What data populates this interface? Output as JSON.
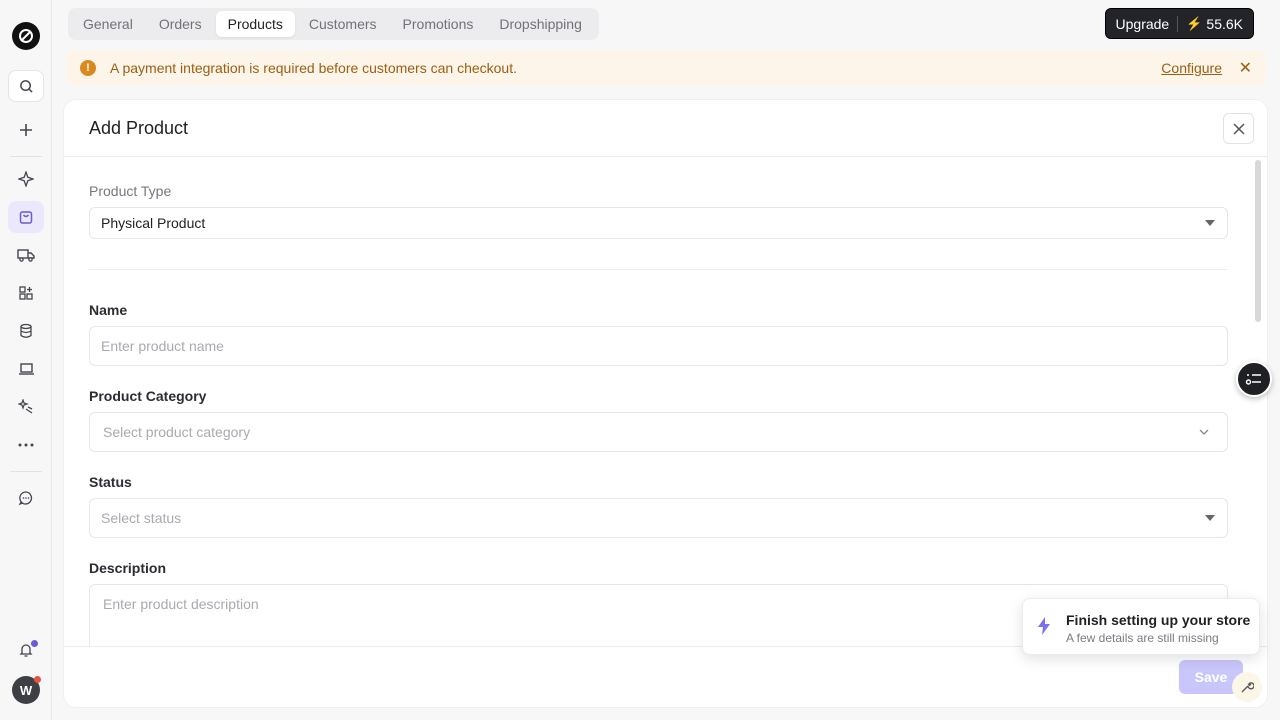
{
  "tabs": [
    {
      "label": "General"
    },
    {
      "label": "Orders"
    },
    {
      "label": "Products"
    },
    {
      "label": "Customers"
    },
    {
      "label": "Promotions"
    },
    {
      "label": "Dropshipping"
    }
  ],
  "active_tab": "Products",
  "upgrade": {
    "label": "Upgrade",
    "credits": "55.6K"
  },
  "banner": {
    "message": "A payment integration is required before customers can checkout.",
    "action": "Configure"
  },
  "panel": {
    "title": "Add Product",
    "product_type": {
      "label": "Product Type",
      "value": "Physical Product"
    },
    "name": {
      "label": "Name",
      "placeholder": "Enter product name"
    },
    "category": {
      "label": "Product Category",
      "placeholder": "Select product category"
    },
    "status": {
      "label": "Status",
      "placeholder": "Select status"
    },
    "description": {
      "label": "Description",
      "placeholder": "Enter product description"
    },
    "save_label": "Save"
  },
  "toast": {
    "title": "Finish setting up your store",
    "subtitle": "A few details are still missing"
  },
  "avatar": {
    "initial": "W"
  },
  "colors": {
    "accent": "#6a5bd8",
    "warning": "#d98a1e",
    "banner_bg": "#fdf5ea"
  }
}
